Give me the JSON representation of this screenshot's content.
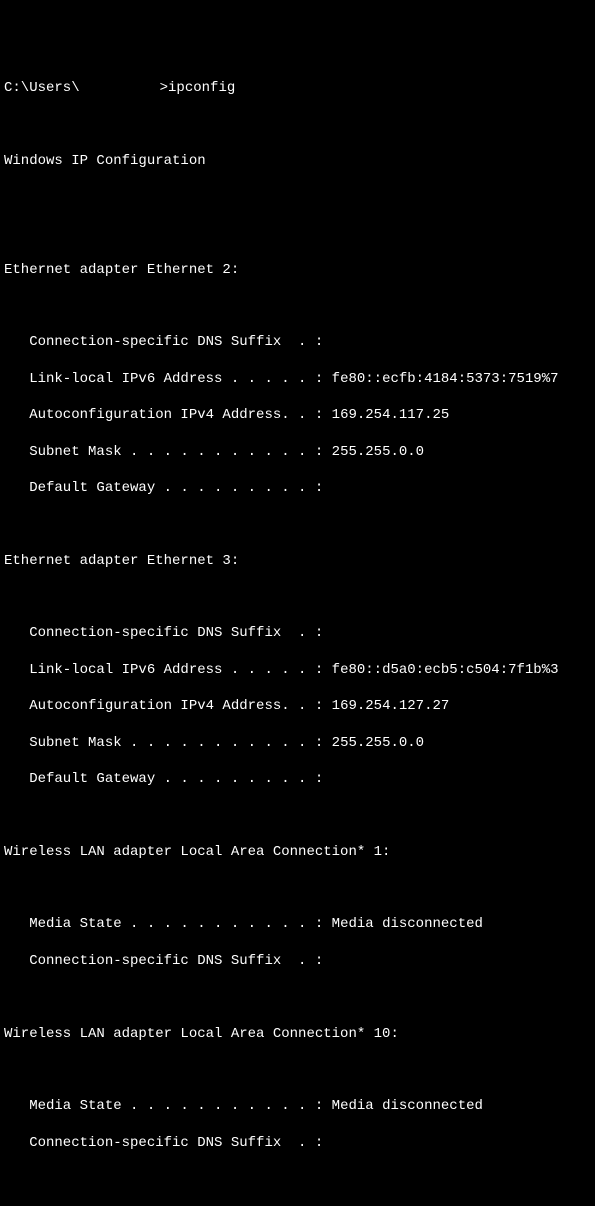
{
  "prompt": {
    "prefix": "C:\\Users\\",
    "user_redacted": true,
    "suffix": ">",
    "command": "ipconfig"
  },
  "header": "Windows IP Configuration",
  "adapters": [
    {
      "title": "Ethernet adapter Ethernet 2:",
      "lines": [
        {
          "label": "   Connection-specific DNS Suffix  . :",
          "value": ""
        },
        {
          "label": "   Link-local IPv6 Address . . . . . :",
          "value": "fe80::ecfb:4184:5373:7519%7"
        },
        {
          "label": "   Autoconfiguration IPv4 Address. . :",
          "value": "169.254.117.25"
        },
        {
          "label": "   Subnet Mask . . . . . . . . . . . :",
          "value": "255.255.0.0"
        },
        {
          "label": "   Default Gateway . . . . . . . . . :",
          "value": ""
        }
      ]
    },
    {
      "title": "Ethernet adapter Ethernet 3:",
      "lines": [
        {
          "label": "   Connection-specific DNS Suffix  . :",
          "value": ""
        },
        {
          "label": "   Link-local IPv6 Address . . . . . :",
          "value": "fe80::d5a0:ecb5:c504:7f1b%3"
        },
        {
          "label": "   Autoconfiguration IPv4 Address. . :",
          "value": "169.254.127.27"
        },
        {
          "label": "   Subnet Mask . . . . . . . . . . . :",
          "value": "255.255.0.0"
        },
        {
          "label": "   Default Gateway . . . . . . . . . :",
          "value": ""
        }
      ]
    },
    {
      "title": "Wireless LAN adapter Local Area Connection* 1:",
      "lines": [
        {
          "label": "   Media State . . . . . . . . . . . :",
          "value": "Media disconnected"
        },
        {
          "label": "   Connection-specific DNS Suffix  . :",
          "value": ""
        }
      ]
    },
    {
      "title": "Wireless LAN adapter Local Area Connection* 10:",
      "lines": [
        {
          "label": "   Media State . . . . . . . . . . . :",
          "value": "Media disconnected"
        },
        {
          "label": "   Connection-specific DNS Suffix  . :",
          "value": ""
        }
      ]
    }
  ]
}
